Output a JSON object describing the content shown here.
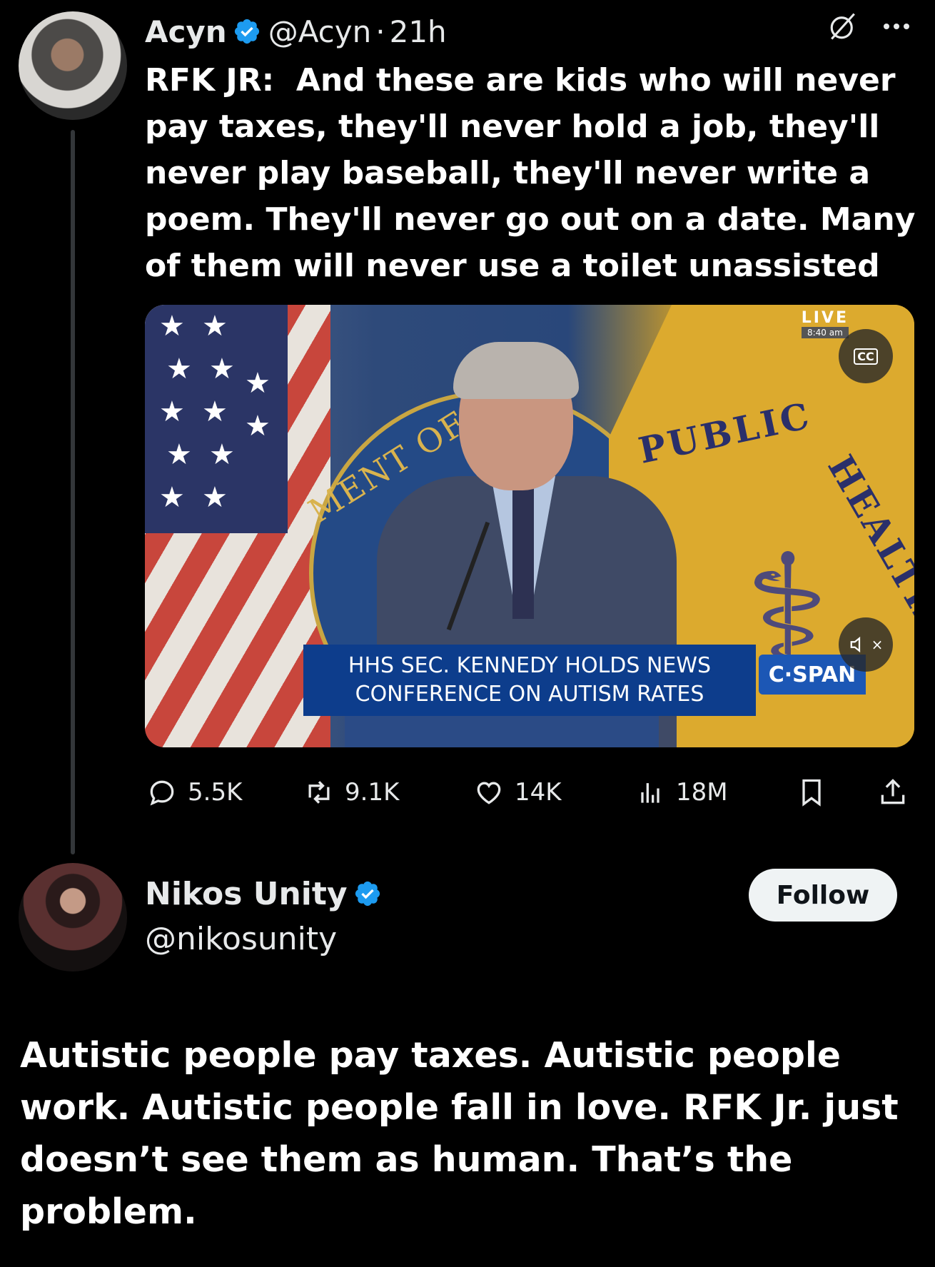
{
  "tweet": {
    "author_name": "Acyn",
    "handle": "@Acyn",
    "separator": "·",
    "time": "21h",
    "text": "RFK JR:  And these are kids who will never pay taxes, they'll never hold a job, they'll never play baseball, they'll never write a poem. They'll never go out on a date. Many of them will never use a toilet unassisted",
    "video": {
      "lower_third_line1": "HHS SEC. KENNEDY HOLDS NEWS",
      "lower_third_line2": "CONFERENCE ON AUTISM RATES",
      "network": "C·SPAN",
      "live_label": "LIVE",
      "live_time": "8:40 am",
      "seal_text": "MENT OF",
      "flag_text_top": "PUBLIC",
      "flag_text_side": "HEALTH",
      "cc_label": "CC",
      "mute_label": "×"
    },
    "stats": {
      "replies": "5.5K",
      "reposts": "9.1K",
      "likes": "14K",
      "views": "18M"
    }
  },
  "reply": {
    "author_name": "Nikos Unity",
    "handle": "@nikosunity",
    "follow_label": "Follow",
    "text": "Autistic people pay taxes. Autistic people work. Autistic people fall in love. RFK Jr. just doesn’t see them as human. That’s the problem."
  },
  "colors": {
    "background": "#000000",
    "verified_blue": "#1d9bf0",
    "text": "#e7e9ea",
    "follow_bg": "#eff3f4"
  },
  "icons": [
    "verified-icon",
    "grok-icon",
    "more-icon",
    "reply-icon",
    "repost-icon",
    "like-icon",
    "views-icon",
    "bookmark-icon",
    "share-icon",
    "cc-icon",
    "mute-icon"
  ]
}
